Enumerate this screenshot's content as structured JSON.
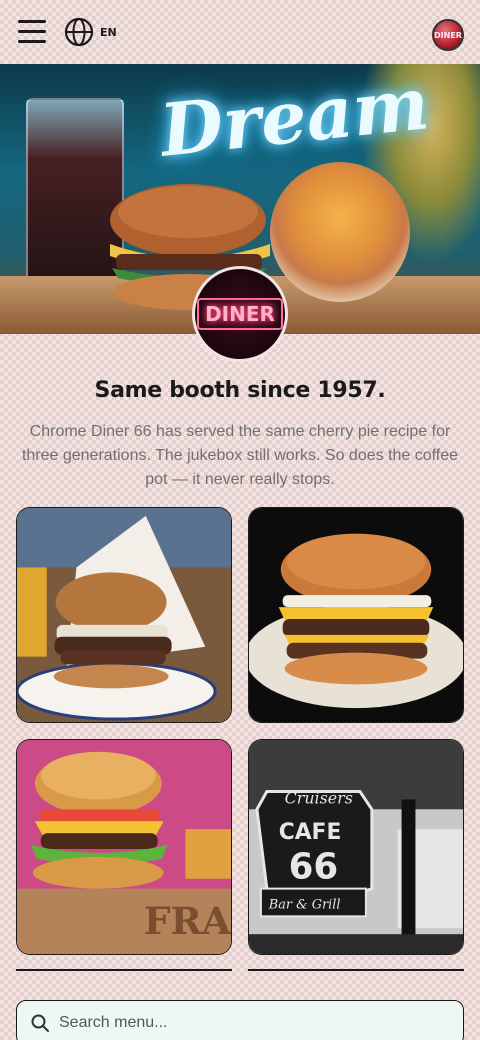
{
  "header": {
    "menu_icon": "hamburger-menu-icon",
    "language_icon": "globe-icon",
    "language_label": "EN",
    "avatar_text": "DINER"
  },
  "hero": {
    "sign_text": "Dream",
    "badge_text": "DINER"
  },
  "intro": {
    "headline": "Same booth since 1957.",
    "body": "Chrome Diner 66 has served the same cherry pie recipe for three generations. The jukebox still works. So does the coffee pot — it never really stops."
  },
  "gallery": {
    "cafe_sign_top": "Cruisers",
    "cafe_sign_main": "CAFE",
    "cafe_sign_number": "66",
    "cafe_sign_bottom": "Bar & Grill",
    "crate_text": "FRA"
  },
  "search": {
    "placeholder": "Search menu...",
    "icon": "search-icon"
  },
  "colors": {
    "background": "#f2e4e2",
    "search_bg": "#eef8f2",
    "text_dark": "#1a1a1a",
    "text_muted": "#707070"
  }
}
